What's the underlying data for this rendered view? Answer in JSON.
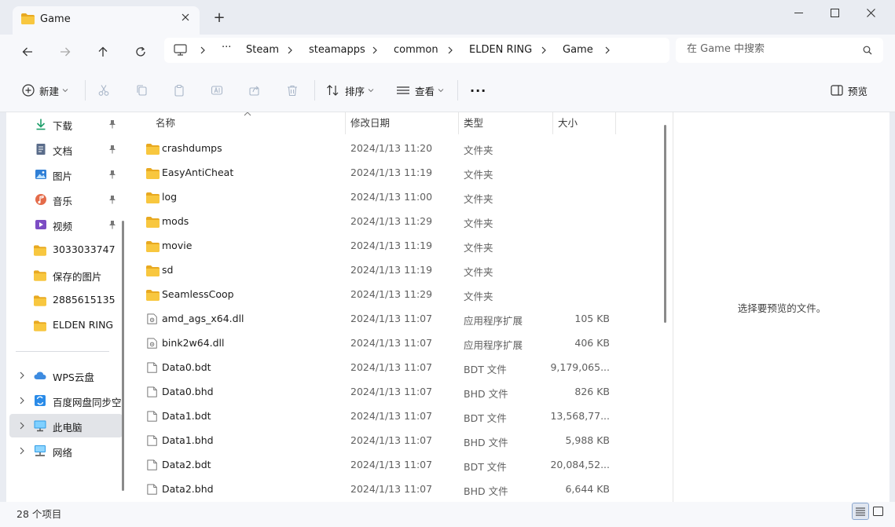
{
  "window": {
    "tab_title": "Game",
    "new_tab_label": "+"
  },
  "address": {
    "crumbs": [
      "Steam",
      "steamapps",
      "common",
      "ELDEN RING",
      "Game"
    ],
    "overflow_label": "···"
  },
  "search": {
    "placeholder": "在 Game 中搜索"
  },
  "commands": {
    "new_label": "新建",
    "sort_label": "排序",
    "view_label": "查看",
    "more_label": "···",
    "preview_label": "预览"
  },
  "sidebar": {
    "quick_access": [
      {
        "label": "下载",
        "icon": "download-icon",
        "pinned": true
      },
      {
        "label": "文档",
        "icon": "document-icon",
        "pinned": true
      },
      {
        "label": "图片",
        "icon": "picture-icon",
        "pinned": true
      },
      {
        "label": "音乐",
        "icon": "music-icon",
        "pinned": true
      },
      {
        "label": "视频",
        "icon": "video-icon",
        "pinned": true
      },
      {
        "label": "3033033747",
        "icon": "folder-icon",
        "pinned": false
      },
      {
        "label": "保存的图片",
        "icon": "folder-icon",
        "pinned": false
      },
      {
        "label": "2885615135",
        "icon": "folder-icon",
        "pinned": false
      },
      {
        "label": "ELDEN RING",
        "icon": "folder-icon",
        "pinned": false
      }
    ],
    "locations": [
      {
        "label": "WPS云盘",
        "icon": "cloud-icon"
      },
      {
        "label": "百度网盘同步空",
        "icon": "baidu-sync-icon"
      },
      {
        "label": "此电脑",
        "icon": "this-pc-icon"
      },
      {
        "label": "网络",
        "icon": "network-icon"
      }
    ]
  },
  "columns": {
    "name": "名称",
    "modified": "修改日期",
    "type": "类型",
    "size": "大小"
  },
  "files": [
    {
      "name": "crashdumps",
      "modified": "2024/1/13 11:20",
      "type": "文件夹",
      "size": "",
      "icon": "folder-icon"
    },
    {
      "name": "EasyAntiCheat",
      "modified": "2024/1/13 11:19",
      "type": "文件夹",
      "size": "",
      "icon": "folder-icon"
    },
    {
      "name": "log",
      "modified": "2024/1/13 11:00",
      "type": "文件夹",
      "size": "",
      "icon": "folder-icon"
    },
    {
      "name": "mods",
      "modified": "2024/1/13 11:29",
      "type": "文件夹",
      "size": "",
      "icon": "folder-icon"
    },
    {
      "name": "movie",
      "modified": "2024/1/13 11:19",
      "type": "文件夹",
      "size": "",
      "icon": "folder-icon"
    },
    {
      "name": "sd",
      "modified": "2024/1/13 11:19",
      "type": "文件夹",
      "size": "",
      "icon": "folder-icon"
    },
    {
      "name": "SeamlessCoop",
      "modified": "2024/1/13 11:29",
      "type": "文件夹",
      "size": "",
      "icon": "folder-icon"
    },
    {
      "name": "amd_ags_x64.dll",
      "modified": "2024/1/13 11:07",
      "type": "应用程序扩展",
      "size": "105 KB",
      "icon": "dll-file-icon"
    },
    {
      "name": "bink2w64.dll",
      "modified": "2024/1/13 11:07",
      "type": "应用程序扩展",
      "size": "406 KB",
      "icon": "dll-file-icon"
    },
    {
      "name": "Data0.bdt",
      "modified": "2024/1/13 11:07",
      "type": "BDT 文件",
      "size": "9,179,065...",
      "icon": "file-icon"
    },
    {
      "name": "Data0.bhd",
      "modified": "2024/1/13 11:07",
      "type": "BHD 文件",
      "size": "826 KB",
      "icon": "file-icon"
    },
    {
      "name": "Data1.bdt",
      "modified": "2024/1/13 11:07",
      "type": "BDT 文件",
      "size": "13,568,77...",
      "icon": "file-icon"
    },
    {
      "name": "Data1.bhd",
      "modified": "2024/1/13 11:07",
      "type": "BHD 文件",
      "size": "5,988 KB",
      "icon": "file-icon"
    },
    {
      "name": "Data2.bdt",
      "modified": "2024/1/13 11:07",
      "type": "BDT 文件",
      "size": "20,084,52...",
      "icon": "file-icon"
    },
    {
      "name": "Data2.bhd",
      "modified": "2024/1/13 11:07",
      "type": "BHD 文件",
      "size": "6,644 KB",
      "icon": "file-icon"
    }
  ],
  "preview": {
    "empty_text": "选择要预览的文件。"
  },
  "status": {
    "item_count": "28 个项目"
  },
  "colors": {
    "folder": "#f8c73f",
    "folder_dark": "#e8a921",
    "accent": "#1a6fd1",
    "download_green": "#1e9e6a"
  }
}
